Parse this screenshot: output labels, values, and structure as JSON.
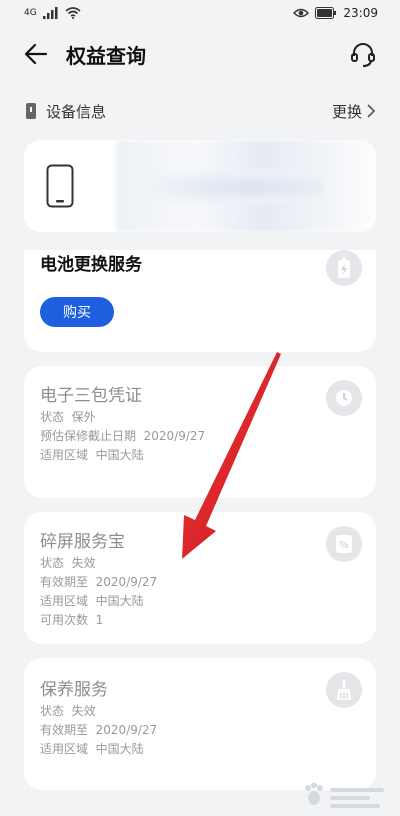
{
  "status_bar": {
    "network": "4G",
    "time": "23:09"
  },
  "header": {
    "title": "权益查询",
    "back_icon": "back-arrow-icon",
    "service_icon": "customer-service-icon"
  },
  "device_section": {
    "label": "设备信息",
    "replace_label": "更换"
  },
  "cards": [
    {
      "title": "电池更换服务",
      "button": "购买",
      "icon": "battery-icon"
    },
    {
      "title": "电子三包凭证",
      "icon": "clock-icon",
      "rows": [
        {
          "k": "状态",
          "v": "保外"
        },
        {
          "k": "预估保修截止日期",
          "v": "2020/9/27"
        },
        {
          "k": "适用区域",
          "v": "中国大陆"
        }
      ]
    },
    {
      "title": "碎屏服务宝",
      "icon": "percent-tag-icon",
      "rows": [
        {
          "k": "状态",
          "v": "失效"
        },
        {
          "k": "有效期至",
          "v": "2020/9/27"
        },
        {
          "k": "适用区域",
          "v": "中国大陆"
        },
        {
          "k": "可用次数",
          "v": "1"
        }
      ]
    },
    {
      "title": "保养服务",
      "icon": "broom-icon",
      "rows": [
        {
          "k": "状态",
          "v": "失效"
        },
        {
          "k": "有效期至",
          "v": "2020/9/27"
        },
        {
          "k": "适用区域",
          "v": "中国大陆"
        }
      ]
    }
  ],
  "colors": {
    "accent": "#1e5fe0",
    "background": "#f1f3f5",
    "arrow": "#e8202a"
  }
}
